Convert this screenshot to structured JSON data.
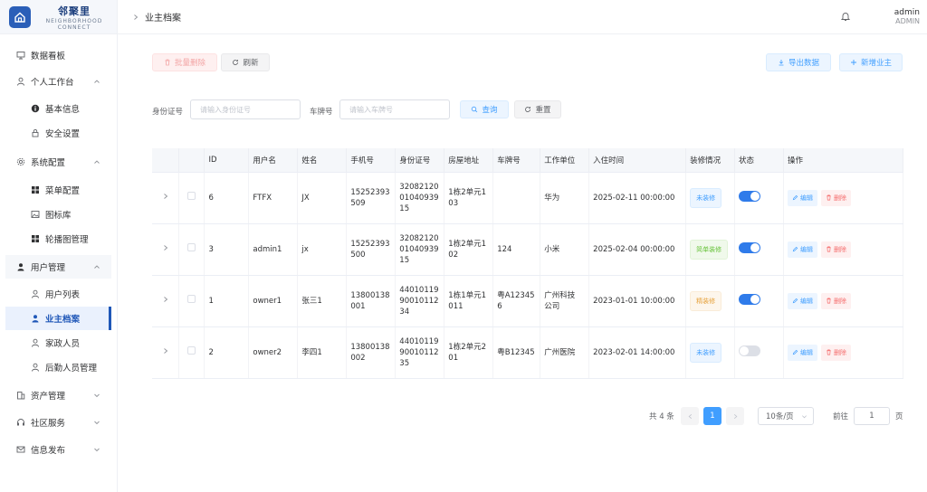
{
  "brand": {
    "name": "邻聚里",
    "sub1": "NEIGHBORHOOD",
    "sub2": "CONNECT"
  },
  "sidebar": {
    "items": [
      {
        "label": "数据看板",
        "icon": "monitor-icon"
      },
      {
        "label": "个人工作台",
        "icon": "user-icon"
      },
      {
        "label": "基本信息",
        "icon": "info-icon"
      },
      {
        "label": "安全设置",
        "icon": "lock-icon"
      },
      {
        "label": "系统配置",
        "icon": "gear-icon"
      },
      {
        "label": "菜单配置",
        "icon": "grid-icon"
      },
      {
        "label": "图标库",
        "icon": "image-icon"
      },
      {
        "label": "轮播图管理",
        "icon": "grid-icon"
      },
      {
        "label": "用户管理",
        "icon": "user-icon"
      },
      {
        "label": "用户列表",
        "icon": "user-icon"
      },
      {
        "label": "业主档案",
        "icon": "user-icon"
      },
      {
        "label": "家政人员",
        "icon": "user-icon"
      },
      {
        "label": "后勤人员管理",
        "icon": "user-icon"
      },
      {
        "label": "资产管理",
        "icon": "building-icon"
      },
      {
        "label": "社区服务",
        "icon": "headset-icon"
      },
      {
        "label": "信息发布",
        "icon": "mail-icon"
      }
    ]
  },
  "header": {
    "breadcrumb": "业主档案",
    "user_name": "admin",
    "user_role": "ADMIN"
  },
  "toolbar": {
    "batch_delete": "批量删除",
    "refresh": "刷新",
    "export": "导出数据",
    "add": "新增业主"
  },
  "filters": {
    "id_label": "身份证号",
    "id_placeholder": "请输入身份证号",
    "plate_label": "车牌号",
    "plate_placeholder": "请输入车牌号",
    "query": "查询",
    "reset": "重置"
  },
  "table": {
    "headers": [
      "ID",
      "用户名",
      "姓名",
      "手机号",
      "身份证号",
      "房屋地址",
      "车牌号",
      "工作单位",
      "入住时间",
      "装修情况",
      "状态",
      "操作"
    ],
    "edit": "编辑",
    "delete": "删除",
    "rows": [
      {
        "id": "6",
        "username": "FTFX",
        "name": "JX",
        "phone": [
          "15252393",
          "509"
        ],
        "idcard": [
          "32082120",
          "01040939",
          "15"
        ],
        "address": [
          "1栋2单元1",
          "03"
        ],
        "plate": [
          ""
        ],
        "company": [
          "华为"
        ],
        "checkin": "2025-02-11 00:00:00",
        "deco": "未装修",
        "deco_color": "#409eff",
        "status": "on"
      },
      {
        "id": "3",
        "username": "admin1",
        "name": "jx",
        "phone": [
          "15252393",
          "500"
        ],
        "idcard": [
          "32082120",
          "01040939",
          "15"
        ],
        "address": [
          "1栋2单元1",
          "02"
        ],
        "plate": [
          "124"
        ],
        "company": [
          "小米"
        ],
        "checkin": "2025-02-04 00:00:00",
        "deco": "简单装修",
        "deco_color": "#67c23a",
        "status": "on"
      },
      {
        "id": "1",
        "username": "owner1",
        "name": "张三1",
        "phone": [
          "13800138",
          "001"
        ],
        "idcard": [
          "44010119",
          "90010112",
          "34"
        ],
        "address": [
          "1栋1单元1",
          "011"
        ],
        "plate": [
          "粤A12345",
          "6"
        ],
        "company": [
          "广州科技",
          "公司"
        ],
        "checkin": "2023-01-01 10:00:00",
        "deco": "精装修",
        "deco_color": "#e6a23c",
        "status": "on"
      },
      {
        "id": "2",
        "username": "owner2",
        "name": "李四1",
        "phone": [
          "13800138",
          "002"
        ],
        "idcard": [
          "44010119",
          "90010112",
          "35"
        ],
        "address": [
          "1栋2单元2",
          "01"
        ],
        "plate": [
          "粤B12345"
        ],
        "company": [
          "广州医院"
        ],
        "checkin": "2023-02-01 14:00:00",
        "deco": "未装修",
        "deco_color": "#409eff",
        "status": "off"
      }
    ]
  },
  "pagination": {
    "total": "共 4 条",
    "current": "1",
    "page_size": "10条/页",
    "goto": "前往",
    "goto_value": "1",
    "page_unit": "页"
  },
  "colors": {
    "accent": "#1f57b8",
    "primary": "#409eff",
    "danger": "#f56c6c"
  }
}
